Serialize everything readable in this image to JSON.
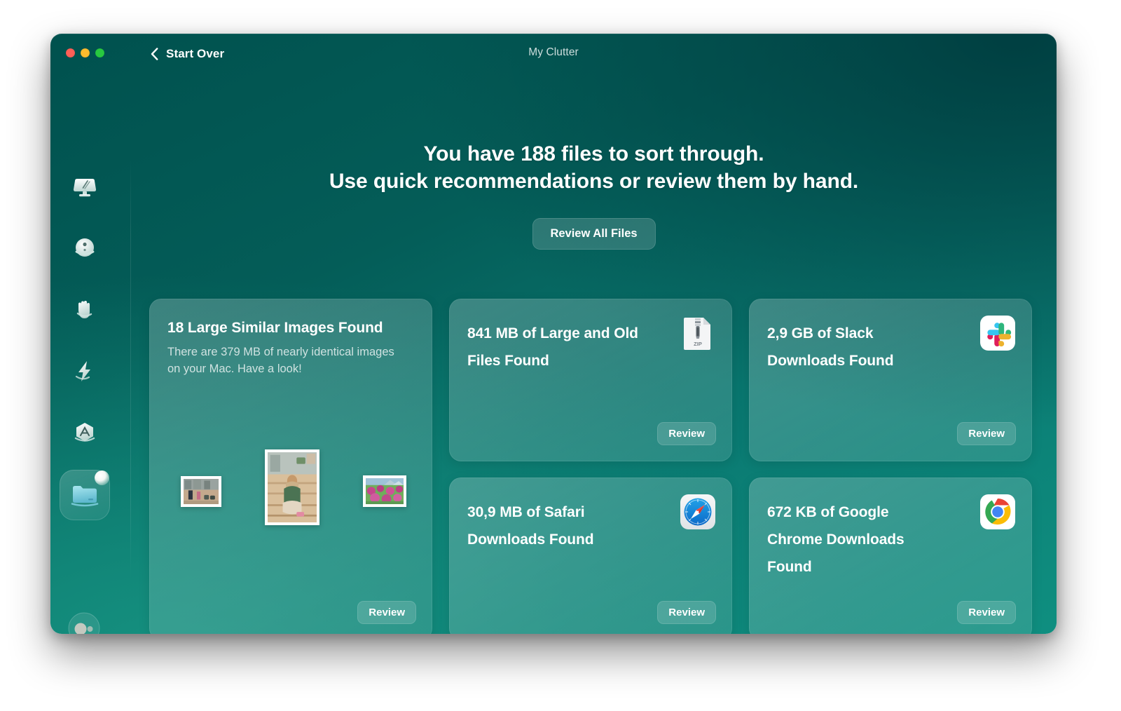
{
  "window": {
    "title": "My Clutter",
    "back_label": "Start Over",
    "traffic_lights": [
      "close-button",
      "minimize-button",
      "maximize-button"
    ]
  },
  "headline": {
    "line1": "You have 188 files to sort through.",
    "line2": "Use quick recommendations or review them by hand.",
    "file_count": 188
  },
  "primary_action": {
    "label": "Review All Files"
  },
  "sidebar": {
    "items": [
      {
        "name": "cleanup",
        "icon": "monitor-broom-icon",
        "selected": false
      },
      {
        "name": "protection",
        "icon": "shield-orb-icon",
        "selected": false
      },
      {
        "name": "privacy",
        "icon": "hand-icon",
        "selected": false
      },
      {
        "name": "performance",
        "icon": "lightning-bolt-icon",
        "selected": false
      },
      {
        "name": "applications",
        "icon": "hexagon-apps-icon",
        "selected": false
      },
      {
        "name": "my-clutter",
        "icon": "folder-icon",
        "selected": true,
        "badge": true
      }
    ],
    "avatar": {
      "icon": "assistant-avatar-icon"
    }
  },
  "cards": [
    {
      "id": "large-similar-images",
      "title": "18 Large Similar Images Found",
      "subtitle": "There are 379 MB of nearly identical images on your Mac. Have a look!",
      "count": 18,
      "size": "379 MB",
      "review_label": "Review",
      "thumbnails": [
        "photo-family-street",
        "photo-woman-sitting-stairs",
        "photo-pink-garden"
      ]
    },
    {
      "id": "large-and-old-files",
      "title_line1": "841 MB of Large and Old",
      "title_line2": "Files Found",
      "size": "841 MB",
      "icon": "zip-file-icon",
      "icon_label": "ZIP",
      "review_label": "Review"
    },
    {
      "id": "slack-downloads",
      "title_line1": "2,9 GB of Slack",
      "title_line2": "Downloads Found",
      "size": "2,9 GB",
      "icon": "slack-app-icon",
      "review_label": "Review"
    },
    {
      "id": "safari-downloads",
      "title_line1": "30,9 MB of Safari",
      "title_line2": "Downloads Found",
      "size": "30,9 MB",
      "icon": "safari-app-icon",
      "review_label": "Review"
    },
    {
      "id": "chrome-downloads",
      "title_line1": "672 KB of Google",
      "title_line2": "Chrome Downloads",
      "title_line3": "Found",
      "size": "672 KB",
      "icon": "google-chrome-app-icon",
      "review_label": "Review"
    }
  ],
  "colors": {
    "bg_dark_teal": "#00514e",
    "bg_bright_teal": "#0f8f80",
    "card_overlay": "#3d8189",
    "text_primary": "#ffffff",
    "text_secondary": "rgba(255,255,255,0.76)",
    "traffic_red": "#ff5f57",
    "traffic_yellow": "#febc2e",
    "traffic_green": "#28c840"
  }
}
